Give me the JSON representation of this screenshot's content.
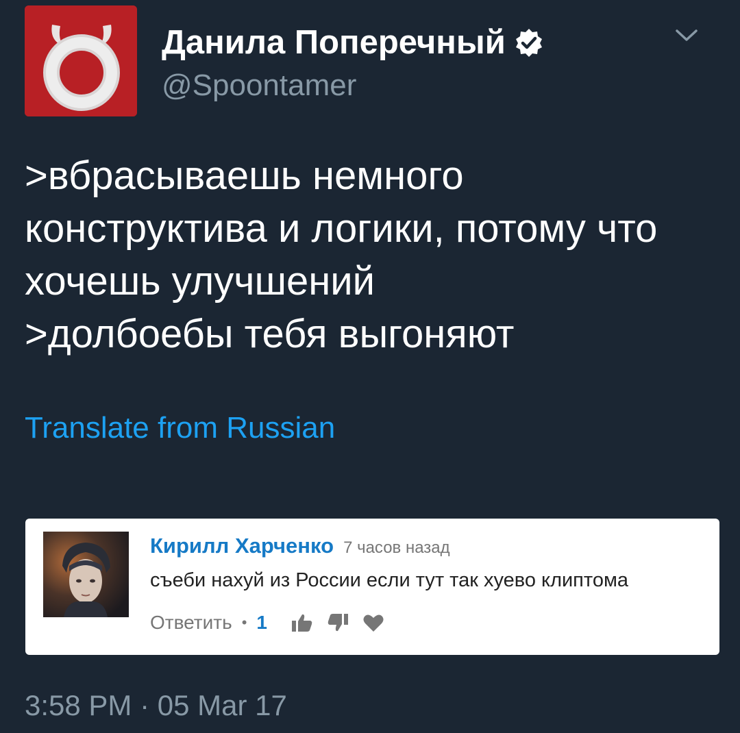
{
  "tweet": {
    "display_name": "Данила Поперечный",
    "handle": "@Spoontamer",
    "text_lines": [
      ">вбрасываешь немного",
      "конструктива и логики, потому что",
      "хочешь улучшений",
      ">долбоебы тебя выгоняют"
    ],
    "translate_label": "Translate from Russian",
    "timestamp": "3:58 PM · 05 Mar 17"
  },
  "embedded_comment": {
    "author": "Кирилл Харченко",
    "time": "7 часов назад",
    "text": "съеби нахуй из России если тут так хуево клиптома",
    "reply_label": "Ответить",
    "separator": "•",
    "like_count": "1"
  },
  "icons": {
    "avatar": "horned-logo-icon",
    "verified": "verified-badge-icon",
    "menu": "chevron-down-icon",
    "like": "thumbs-up-icon",
    "dislike": "thumbs-down-icon",
    "heart": "heart-icon"
  },
  "colors": {
    "background": "#1b2633",
    "brand_red": "#b82025",
    "link_blue": "#1da1f2",
    "muted": "#8899a6",
    "comment_author": "#167ac6"
  }
}
